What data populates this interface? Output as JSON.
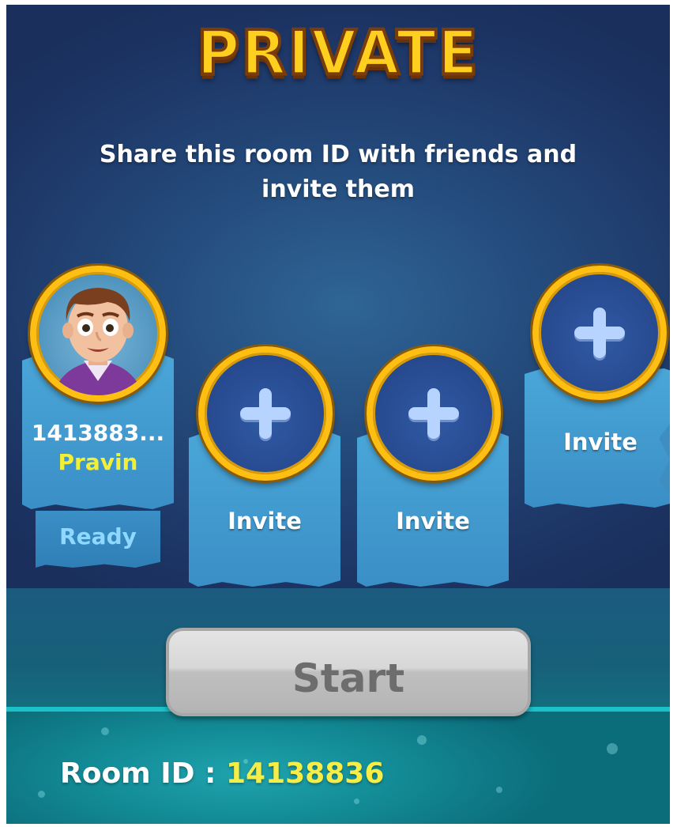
{
  "header": {
    "title": "PRIVATE"
  },
  "subtitle": "Share this room ID with friends and invite them",
  "players": [
    {
      "slot": 1,
      "id": "1413883...",
      "name": "Pravin",
      "status": "Ready"
    }
  ],
  "invite_slots": [
    {
      "label": "Invite"
    },
    {
      "label": "Invite"
    },
    {
      "label": "Invite"
    }
  ],
  "start_button": {
    "label": "Start",
    "enabled": false
  },
  "room": {
    "label": "Room ID :",
    "value": "14138836"
  },
  "colors": {
    "title_gold": "#ffcf1f",
    "ring_gold": "#ffbf12",
    "banner_blue": "#4aa6d8",
    "name_yellow": "#f3ee36",
    "room_id_yellow": "#f6ee46",
    "ready_blue": "#8fd8ff",
    "teal_bar": "#138d98"
  },
  "icons": [
    "avatar-icon",
    "plus-icon"
  ]
}
